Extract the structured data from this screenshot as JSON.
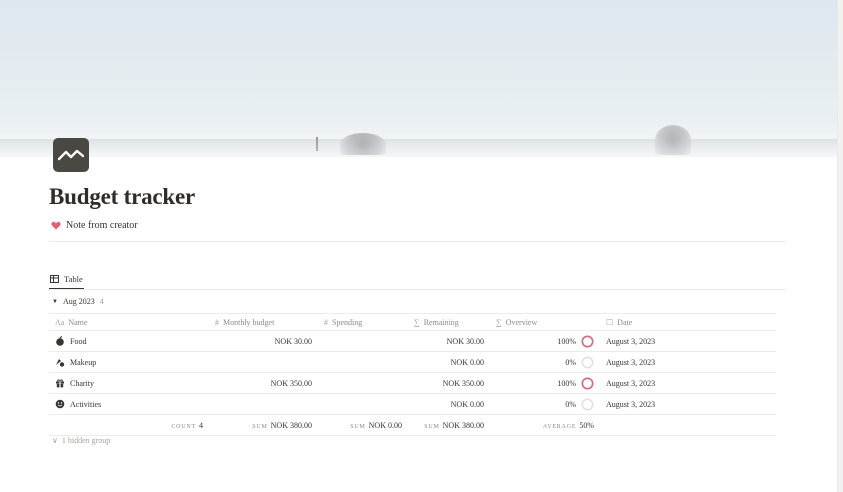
{
  "page": {
    "title": "Budget tracker",
    "icon": "trend-chart-icon",
    "note": "Note from creator"
  },
  "views": [
    {
      "label": "Table",
      "icon": "table-icon"
    }
  ],
  "group": {
    "label": "Aug 2023",
    "count": "4"
  },
  "columns": {
    "name": "Name",
    "budget": "Monthly budget",
    "spending": "Spending",
    "remaining": "Remaining",
    "overview": "Overview",
    "date": "Date"
  },
  "rows": [
    {
      "icon": "apple-icon",
      "name": "Food",
      "budget": "NOK 30.00",
      "spending": "",
      "remaining": "NOK 30.00",
      "overview": "100%",
      "overview_value": 1.0,
      "date": "August 3, 2023"
    },
    {
      "icon": "makeup-icon",
      "name": "Makeup",
      "budget": "",
      "spending": "",
      "remaining": "NOK 0.00",
      "overview": "0%",
      "overview_value": 0.0,
      "date": "August 3, 2023"
    },
    {
      "icon": "gift-icon",
      "name": "Charity",
      "budget": "NOK 350.00",
      "spending": "",
      "remaining": "NOK 350.00",
      "overview": "100%",
      "overview_value": 1.0,
      "date": "August 3, 2023"
    },
    {
      "icon": "smiley-icon",
      "name": "Activities",
      "budget": "",
      "spending": "",
      "remaining": "NOK 0.00",
      "overview": "0%",
      "overview_value": 0.0,
      "date": "August 3, 2023"
    }
  ],
  "calculations": {
    "count_label": "COUNT",
    "count": "4",
    "budget_label": "SUM",
    "budget": "NOK 380.00",
    "spending_label": "SUM",
    "spending": "NOK 0.00",
    "remaining_label": "SUM",
    "remaining": "NOK 380.00",
    "overview_label": "AVERAGE",
    "overview": "50%"
  },
  "hidden_group": "1 hidden group",
  "colors": {
    "ring_full": "#d46a7e",
    "ring_empty": "#e3e2e0"
  }
}
